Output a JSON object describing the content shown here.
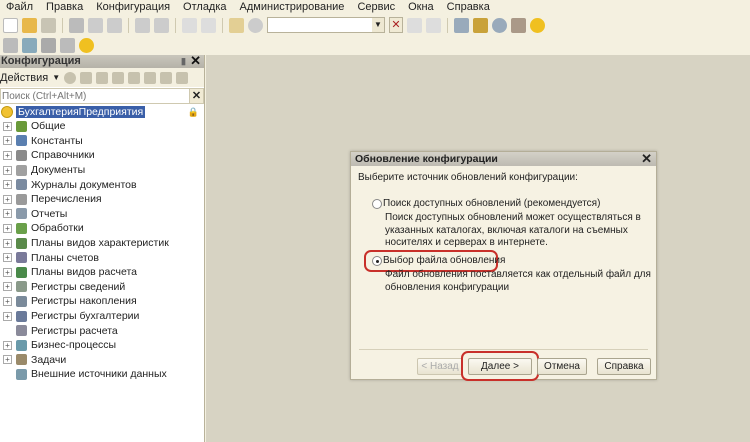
{
  "menu": [
    "Файл",
    "Правка",
    "Конфигурация",
    "Отладка",
    "Администрирование",
    "Сервис",
    "Окна",
    "Справка"
  ],
  "panel": {
    "title": "Конфигурация",
    "actions_label": "Действия",
    "search_placeholder": "Поиск (Ctrl+Alt+M)",
    "root": "БухгалтерияПредприятия",
    "items": [
      {
        "label": "Общие",
        "expand": true,
        "color": "#6a9a3a"
      },
      {
        "label": "Константы",
        "expand": true,
        "color": "#5a7fb0"
      },
      {
        "label": "Справочники",
        "expand": true,
        "color": "#8a8a8a"
      },
      {
        "label": "Документы",
        "expand": true,
        "color": "#a0a0a0"
      },
      {
        "label": "Журналы документов",
        "expand": true,
        "color": "#7a8aa0"
      },
      {
        "label": "Перечисления",
        "expand": true,
        "color": "#9a9a9a"
      },
      {
        "label": "Отчеты",
        "expand": true,
        "color": "#8a9aaa"
      },
      {
        "label": "Обработки",
        "expand": true,
        "color": "#6aa04a"
      },
      {
        "label": "Планы видов характеристик",
        "expand": true,
        "color": "#5a8a4a"
      },
      {
        "label": "Планы счетов",
        "expand": true,
        "color": "#7a7a9a"
      },
      {
        "label": "Планы видов расчета",
        "expand": true,
        "color": "#4a8a4a"
      },
      {
        "label": "Регистры сведений",
        "expand": true,
        "color": "#8a9a8a"
      },
      {
        "label": "Регистры накопления",
        "expand": true,
        "color": "#7a8a9a"
      },
      {
        "label": "Регистры бухгалтерии",
        "expand": true,
        "color": "#6a7a9a"
      },
      {
        "label": "Регистры расчета",
        "expand": false,
        "color": "#8a8a9a"
      },
      {
        "label": "Бизнес-процессы",
        "expand": true,
        "color": "#6a9aaa"
      },
      {
        "label": "Задачи",
        "expand": true,
        "color": "#9a8a6a"
      },
      {
        "label": "Внешние источники данных",
        "expand": false,
        "color": "#7a9aaa"
      }
    ]
  },
  "dialog": {
    "title": "Обновление конфигурации",
    "prompt": "Выберите источник обновлений конфигурации:",
    "option1": "Поиск доступных обновлений (рекомендуется)",
    "option1_desc": "Поиск доступных обновлений может осуществляться в указанных каталогах, включая каталоги на съемных носителях и серверах в интернете.",
    "option2": "Выбор файла обновления",
    "option2_desc": "Файл обновления поставляется как отдельный файл для обновления конфигурации",
    "back": "< Назад",
    "next": "Далее >",
    "cancel": "Отмена",
    "help": "Справка"
  }
}
